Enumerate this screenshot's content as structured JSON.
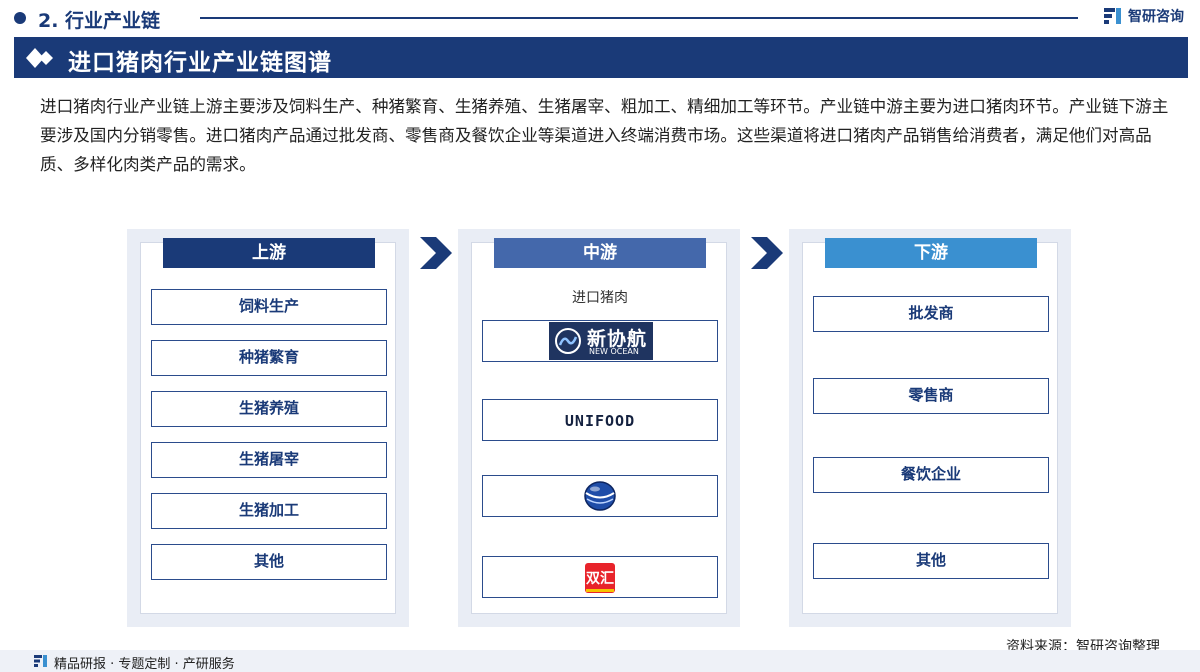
{
  "header": {
    "section_title": "2. 行业产业链",
    "brand_name": "智研咨询"
  },
  "banner": {
    "title": "进口猪肉行业产业链图谱"
  },
  "description": "进口猪肉行业产业链上游主要涉及饲料生产、种猪繁育、生猪养殖、生猪屠宰、粗加工、精细加工等环节。产业链中游主要为进口猪肉环节。产业链下游主要涉及国内分销零售。进口猪肉产品通过批发商、零售商及餐饮企业等渠道进入终端消费市场。这些渠道将进口猪肉产品销售给消费者，满足他们对高品质、多样化肉类产品的需求。",
  "upstream": {
    "title": "上游",
    "items": [
      "饲料生产",
      "种猪繁育",
      "生猪养殖",
      "生猪屠宰",
      "生猪加工",
      "其他"
    ]
  },
  "midstream": {
    "title": "中游",
    "label": "进口猪肉",
    "logos": [
      {
        "name": "new-ocean-logo",
        "text_cn": "新协航",
        "text_en": "NEW OCEAN"
      },
      {
        "name": "unifood-logo",
        "text": "UNIFOOD"
      },
      {
        "name": "globe-logo"
      },
      {
        "name": "shuanghui-logo",
        "text": "双汇"
      }
    ]
  },
  "downstream": {
    "title": "下游",
    "items": [
      "批发商",
      "零售商",
      "餐饮企业",
      "其他"
    ]
  },
  "source": "资料来源：智研咨询整理",
  "footer": {
    "text": "精品研报 · 专题定制 · 产研服务"
  },
  "colors": {
    "primary": "#1a3a78",
    "mid_header": "#4468ab",
    "light_header": "#3a90d0",
    "panel_bg": "#e9edf5"
  }
}
